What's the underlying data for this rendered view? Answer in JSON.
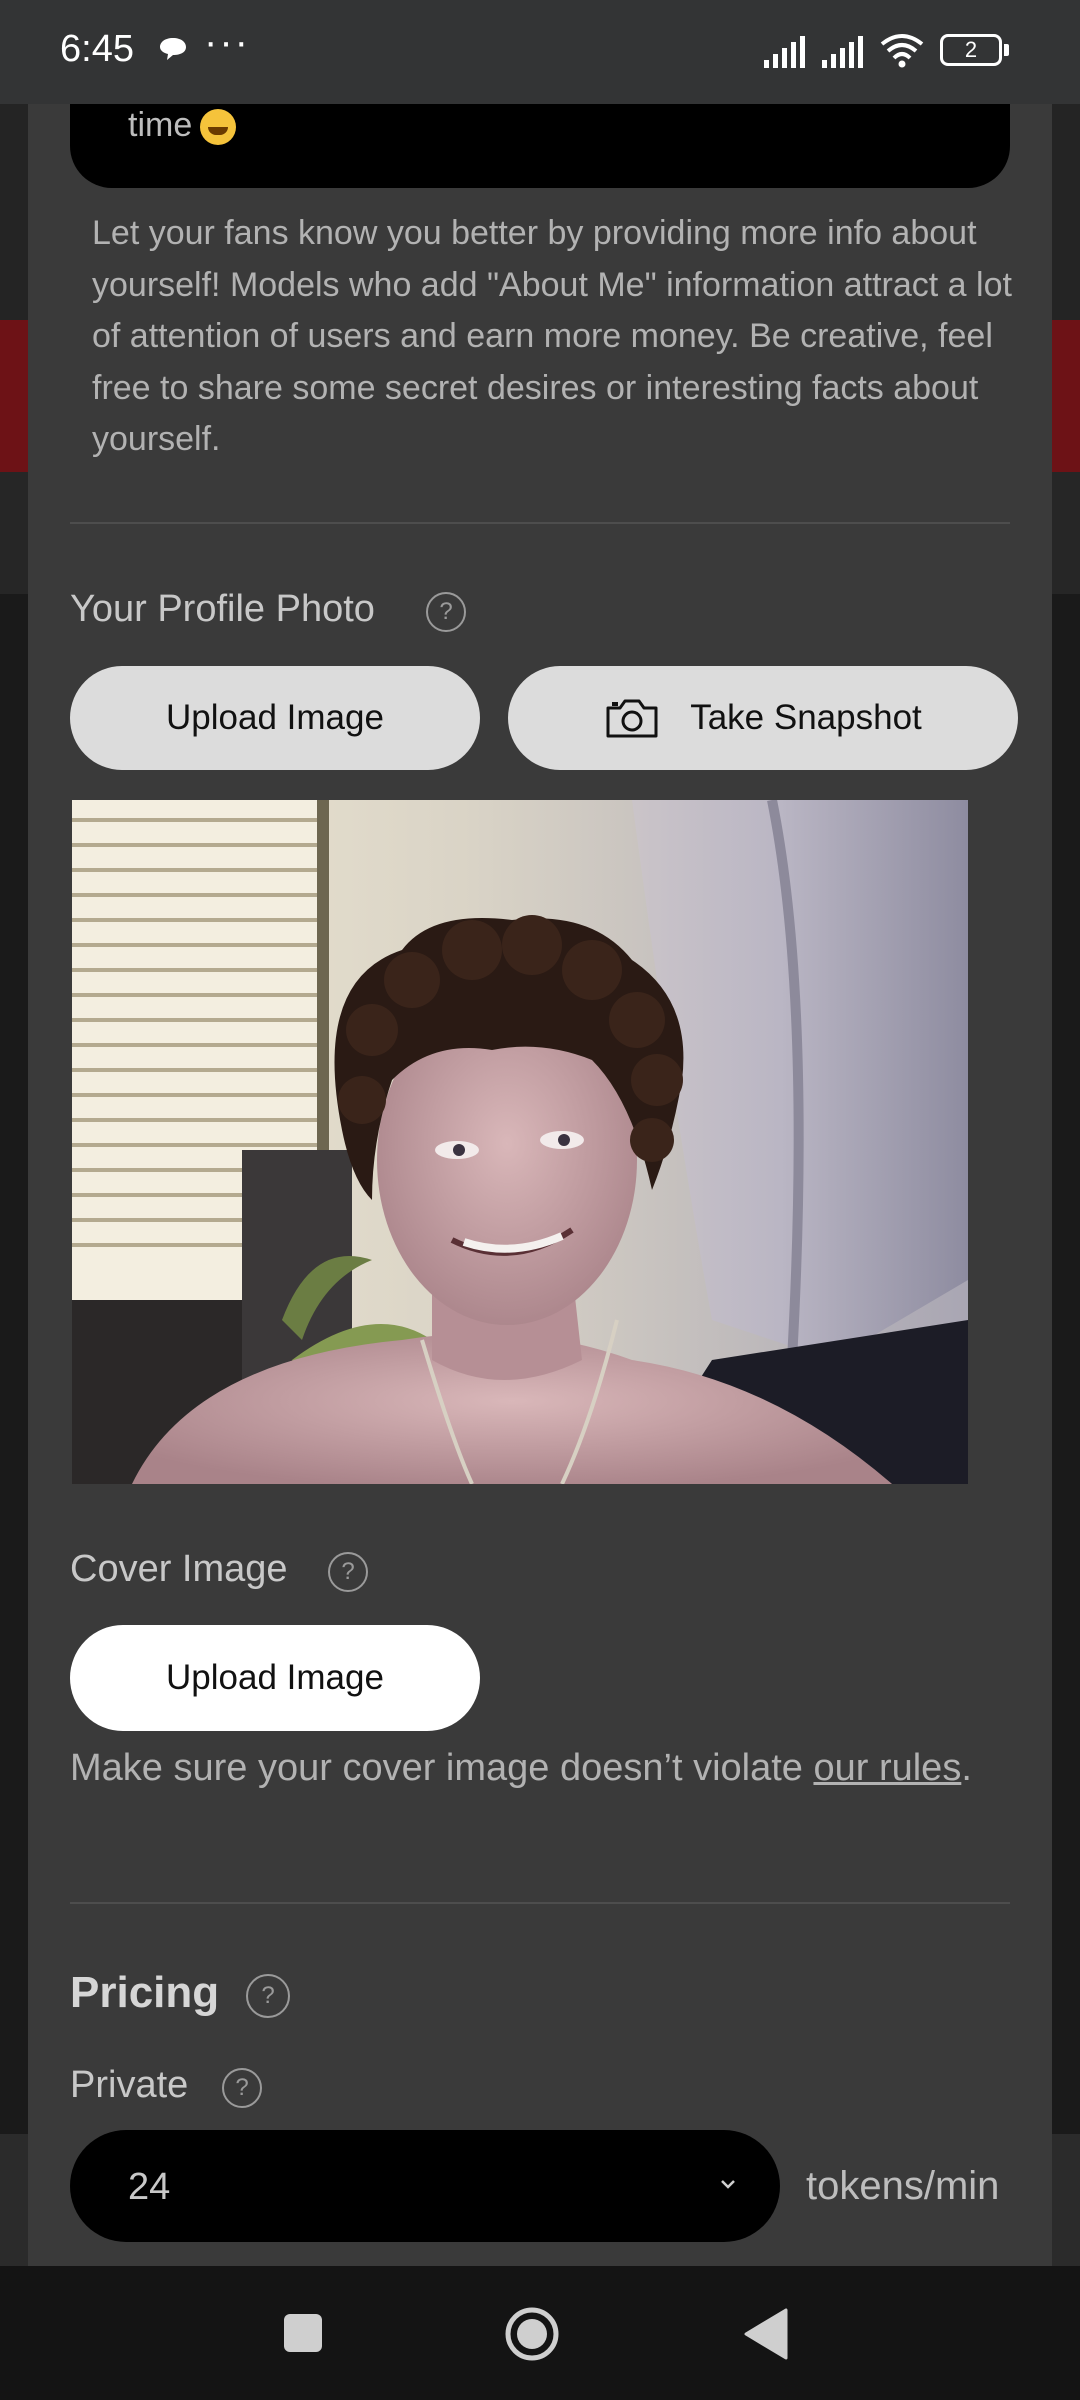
{
  "status_bar": {
    "time": "6:45",
    "dots": "···",
    "battery_level": "2"
  },
  "about_me": {
    "field_tail_text": "time",
    "help_text": "Let your fans know you better by providing more info about yourself! Models who add \"About Me\" information attract a lot of attention of users and earn more money. Be creative, feel free to share some secret desires or interesting facts about yourself."
  },
  "profile_photo": {
    "label": "Your Profile Photo",
    "help_glyph": "?",
    "upload_label": "Upload Image",
    "snapshot_label": "Take Snapshot"
  },
  "cover_image": {
    "label": "Cover Image",
    "help_glyph": "?",
    "upload_label": "Upload Image",
    "note_prefix": "Make sure your cover image doesn’t violate ",
    "note_link": "our rules",
    "note_suffix": "."
  },
  "pricing": {
    "title": "Pricing",
    "help_glyph": "?",
    "private_label": "Private",
    "private_help_glyph": "?",
    "private_value": "24",
    "unit": "tokens/min"
  },
  "colors": {
    "panel": "#3a3a3a",
    "backdrop_red": "#6d1216",
    "button_grey": "#dcdcdc",
    "button_white": "#ffffff",
    "field_black": "#000000"
  },
  "icons": {
    "chat": "chat-bubble-icon",
    "signal": "signal-icon",
    "wifi": "wifi-icon",
    "battery": "battery-icon",
    "camera": "camera-icon",
    "dropdown": "chevron-down-icon",
    "nav_recents": "recents-square-icon",
    "nav_home": "home-circle-icon",
    "nav_back": "back-triangle-icon"
  }
}
